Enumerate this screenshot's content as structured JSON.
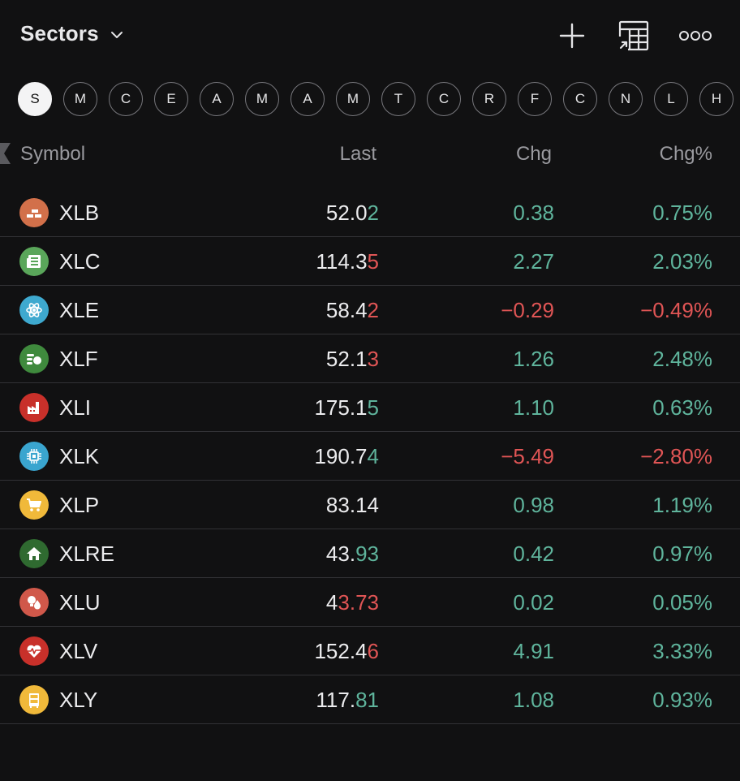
{
  "header": {
    "title": "Sectors"
  },
  "letter_filter": [
    "S",
    "M",
    "C",
    "E",
    "A",
    "M",
    "A",
    "M",
    "T",
    "C",
    "R",
    "F",
    "C",
    "N",
    "L",
    "H"
  ],
  "active_letter": 0,
  "columns": {
    "symbol": "Symbol",
    "last": "Last",
    "chg": "Chg",
    "chg_pct": "Chg%"
  },
  "colors": {
    "background": "#111112",
    "up": "#5fb49c",
    "down": "#e05555",
    "divider": "#323236"
  },
  "rows": [
    {
      "symbol": "XLB",
      "last_base": "52.0",
      "last_hl": "2",
      "last_dir": "up",
      "chg": "0.38",
      "chg_pct": "0.75%",
      "dir": "up",
      "icon": "bricks-icon",
      "icon_color": "#d2704a"
    },
    {
      "symbol": "XLC",
      "last_base": "114.3",
      "last_hl": "5",
      "last_dir": "dn",
      "chg": "2.27",
      "chg_pct": "2.03%",
      "dir": "up",
      "icon": "newspaper-icon",
      "icon_color": "#5aa65a"
    },
    {
      "symbol": "XLE",
      "last_base": "58.4",
      "last_hl": "2",
      "last_dir": "dn",
      "chg": "−0.29",
      "chg_pct": "−0.49%",
      "dir": "dn",
      "icon": "atom-icon",
      "icon_color": "#3ea9cf"
    },
    {
      "symbol": "XLF",
      "last_base": "52.1",
      "last_hl": "3",
      "last_dir": "dn",
      "chg": "1.26",
      "chg_pct": "2.48%",
      "dir": "up",
      "icon": "coins-icon",
      "icon_color": "#3f8a3d"
    },
    {
      "symbol": "XLI",
      "last_base": "175.1",
      "last_hl": "5",
      "last_dir": "up",
      "chg": "1.10",
      "chg_pct": "0.63%",
      "dir": "up",
      "icon": "factory-icon",
      "icon_color": "#c8302a"
    },
    {
      "symbol": "XLK",
      "last_base": "190.7",
      "last_hl": "4",
      "last_dir": "up",
      "chg": "−5.49",
      "chg_pct": "−2.80%",
      "dir": "dn",
      "icon": "chip-icon",
      "icon_color": "#3aa5cf"
    },
    {
      "symbol": "XLP",
      "last_base": "83.14",
      "last_hl": "",
      "last_dir": "up",
      "chg": "0.98",
      "chg_pct": "1.19%",
      "dir": "up",
      "icon": "cart-icon",
      "icon_color": "#f0b93a"
    },
    {
      "symbol": "XLRE",
      "last_base": "43.",
      "last_hl": "93",
      "last_dir": "up",
      "chg": "0.42",
      "chg_pct": "0.97%",
      "dir": "up",
      "icon": "house-icon",
      "icon_color": "#2f6a30"
    },
    {
      "symbol": "XLU",
      "last_base": "4",
      "last_hl": "3.73",
      "last_dir": "dn",
      "chg": "0.02",
      "chg_pct": "0.05%",
      "dir": "up",
      "icon": "bulb-drop-icon",
      "icon_color": "#d0584a"
    },
    {
      "symbol": "XLV",
      "last_base": "152.4",
      "last_hl": "6",
      "last_dir": "dn",
      "chg": "4.91",
      "chg_pct": "3.33%",
      "dir": "up",
      "icon": "heartbeat-icon",
      "icon_color": "#c8302a"
    },
    {
      "symbol": "XLY",
      "last_base": "117.",
      "last_hl": "81",
      "last_dir": "up",
      "chg": "1.08",
      "chg_pct": "0.93%",
      "dir": "up",
      "icon": "dresser-icon",
      "icon_color": "#f0b93a"
    }
  ]
}
